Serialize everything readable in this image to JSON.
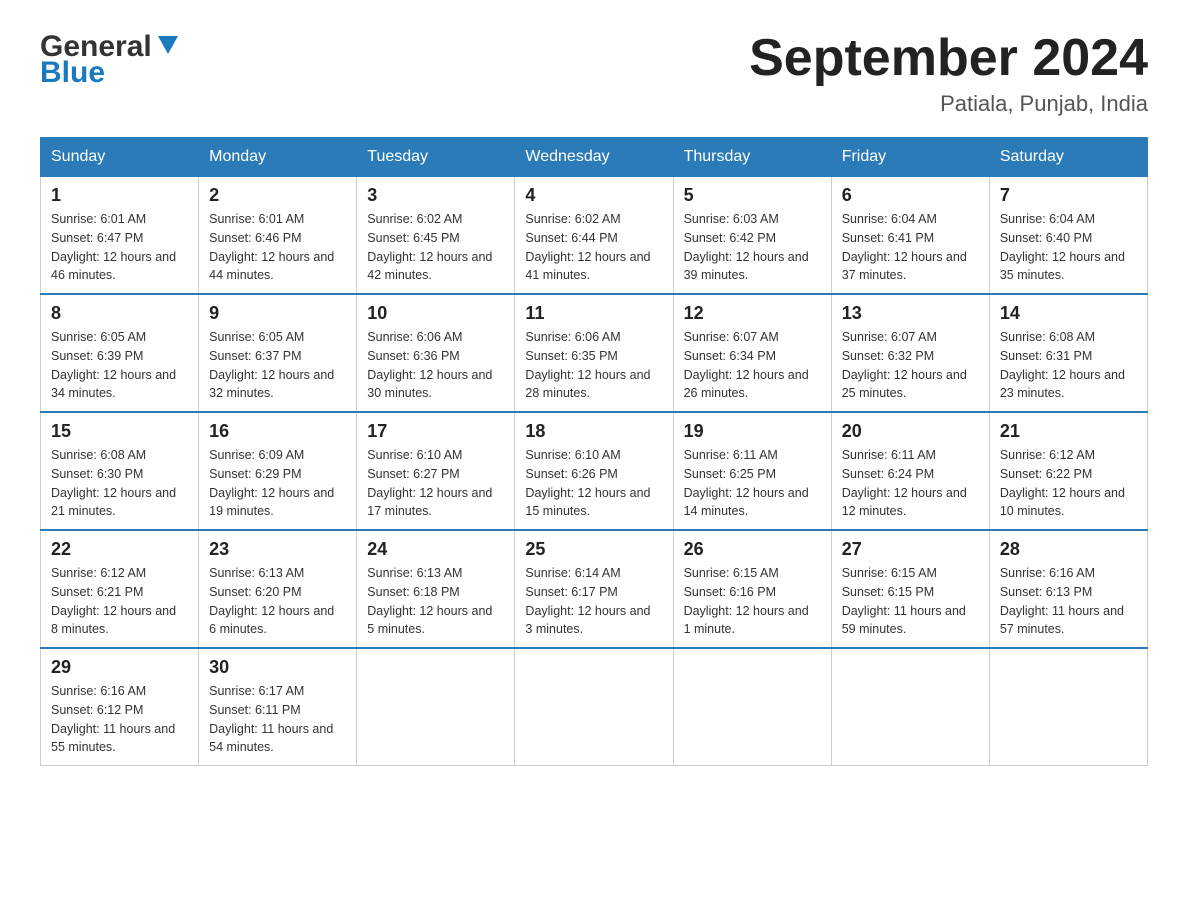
{
  "header": {
    "logo_general": "General",
    "logo_blue": "Blue",
    "month_title": "September 2024",
    "location": "Patiala, Punjab, India"
  },
  "calendar": {
    "days_of_week": [
      "Sunday",
      "Monday",
      "Tuesday",
      "Wednesday",
      "Thursday",
      "Friday",
      "Saturday"
    ],
    "weeks": [
      [
        {
          "day": "1",
          "sunrise": "6:01 AM",
          "sunset": "6:47 PM",
          "daylight": "12 hours and 46 minutes."
        },
        {
          "day": "2",
          "sunrise": "6:01 AM",
          "sunset": "6:46 PM",
          "daylight": "12 hours and 44 minutes."
        },
        {
          "day": "3",
          "sunrise": "6:02 AM",
          "sunset": "6:45 PM",
          "daylight": "12 hours and 42 minutes."
        },
        {
          "day": "4",
          "sunrise": "6:02 AM",
          "sunset": "6:44 PM",
          "daylight": "12 hours and 41 minutes."
        },
        {
          "day": "5",
          "sunrise": "6:03 AM",
          "sunset": "6:42 PM",
          "daylight": "12 hours and 39 minutes."
        },
        {
          "day": "6",
          "sunrise": "6:04 AM",
          "sunset": "6:41 PM",
          "daylight": "12 hours and 37 minutes."
        },
        {
          "day": "7",
          "sunrise": "6:04 AM",
          "sunset": "6:40 PM",
          "daylight": "12 hours and 35 minutes."
        }
      ],
      [
        {
          "day": "8",
          "sunrise": "6:05 AM",
          "sunset": "6:39 PM",
          "daylight": "12 hours and 34 minutes."
        },
        {
          "day": "9",
          "sunrise": "6:05 AM",
          "sunset": "6:37 PM",
          "daylight": "12 hours and 32 minutes."
        },
        {
          "day": "10",
          "sunrise": "6:06 AM",
          "sunset": "6:36 PM",
          "daylight": "12 hours and 30 minutes."
        },
        {
          "day": "11",
          "sunrise": "6:06 AM",
          "sunset": "6:35 PM",
          "daylight": "12 hours and 28 minutes."
        },
        {
          "day": "12",
          "sunrise": "6:07 AM",
          "sunset": "6:34 PM",
          "daylight": "12 hours and 26 minutes."
        },
        {
          "day": "13",
          "sunrise": "6:07 AM",
          "sunset": "6:32 PM",
          "daylight": "12 hours and 25 minutes."
        },
        {
          "day": "14",
          "sunrise": "6:08 AM",
          "sunset": "6:31 PM",
          "daylight": "12 hours and 23 minutes."
        }
      ],
      [
        {
          "day": "15",
          "sunrise": "6:08 AM",
          "sunset": "6:30 PM",
          "daylight": "12 hours and 21 minutes."
        },
        {
          "day": "16",
          "sunrise": "6:09 AM",
          "sunset": "6:29 PM",
          "daylight": "12 hours and 19 minutes."
        },
        {
          "day": "17",
          "sunrise": "6:10 AM",
          "sunset": "6:27 PM",
          "daylight": "12 hours and 17 minutes."
        },
        {
          "day": "18",
          "sunrise": "6:10 AM",
          "sunset": "6:26 PM",
          "daylight": "12 hours and 15 minutes."
        },
        {
          "day": "19",
          "sunrise": "6:11 AM",
          "sunset": "6:25 PM",
          "daylight": "12 hours and 14 minutes."
        },
        {
          "day": "20",
          "sunrise": "6:11 AM",
          "sunset": "6:24 PM",
          "daylight": "12 hours and 12 minutes."
        },
        {
          "day": "21",
          "sunrise": "6:12 AM",
          "sunset": "6:22 PM",
          "daylight": "12 hours and 10 minutes."
        }
      ],
      [
        {
          "day": "22",
          "sunrise": "6:12 AM",
          "sunset": "6:21 PM",
          "daylight": "12 hours and 8 minutes."
        },
        {
          "day": "23",
          "sunrise": "6:13 AM",
          "sunset": "6:20 PM",
          "daylight": "12 hours and 6 minutes."
        },
        {
          "day": "24",
          "sunrise": "6:13 AM",
          "sunset": "6:18 PM",
          "daylight": "12 hours and 5 minutes."
        },
        {
          "day": "25",
          "sunrise": "6:14 AM",
          "sunset": "6:17 PM",
          "daylight": "12 hours and 3 minutes."
        },
        {
          "day": "26",
          "sunrise": "6:15 AM",
          "sunset": "6:16 PM",
          "daylight": "12 hours and 1 minute."
        },
        {
          "day": "27",
          "sunrise": "6:15 AM",
          "sunset": "6:15 PM",
          "daylight": "11 hours and 59 minutes."
        },
        {
          "day": "28",
          "sunrise": "6:16 AM",
          "sunset": "6:13 PM",
          "daylight": "11 hours and 57 minutes."
        }
      ],
      [
        {
          "day": "29",
          "sunrise": "6:16 AM",
          "sunset": "6:12 PM",
          "daylight": "11 hours and 55 minutes."
        },
        {
          "day": "30",
          "sunrise": "6:17 AM",
          "sunset": "6:11 PM",
          "daylight": "11 hours and 54 minutes."
        },
        null,
        null,
        null,
        null,
        null
      ]
    ],
    "labels": {
      "sunrise": "Sunrise:",
      "sunset": "Sunset:",
      "daylight": "Daylight:"
    }
  }
}
